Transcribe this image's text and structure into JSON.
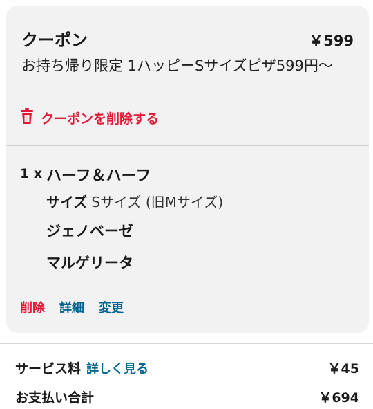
{
  "coupon": {
    "title": "クーポン",
    "price": "￥599",
    "description": "お持ち帰り限定 1ハッピーSサイズピザ599円〜",
    "remove_label": "クーポンを削除する",
    "remove_icon": "trash-icon",
    "accent_color": "#e31837"
  },
  "item": {
    "quantity": "1 x",
    "name": "ハーフ＆ハーフ",
    "size_label": "サイズ",
    "size_value": "Sサイズ (旧Mサイズ)",
    "toppings": [
      "ジェノベーゼ",
      "マルゲリータ"
    ],
    "actions": {
      "delete": "削除",
      "detail": "詳細",
      "change": "変更"
    },
    "link_color": "#006491"
  },
  "summary": {
    "service_fee_label": "サービス料",
    "service_fee_link": "詳しく見る",
    "service_fee_value": "￥45",
    "total_label": "お支払い合計",
    "total_value": "￥694"
  }
}
